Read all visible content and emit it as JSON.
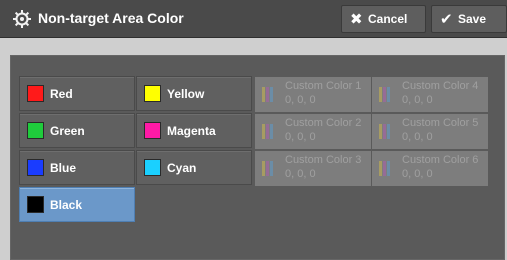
{
  "header": {
    "title": "Non-target Area Color",
    "cancel_label": "Cancel",
    "save_label": "Save"
  },
  "colors": [
    {
      "label": "Red",
      "color": "#ff1a1a"
    },
    {
      "label": "Yellow",
      "color": "#ffff00"
    },
    {
      "label": "Green",
      "color": "#1fcc3c"
    },
    {
      "label": "Magenta",
      "color": "#ff1aa6"
    },
    {
      "label": "Blue",
      "color": "#1a3cff"
    },
    {
      "label": "Cyan",
      "color": "#1ad0ff"
    },
    {
      "label": "Black",
      "color": "#000000",
      "selected": true
    }
  ],
  "custom_colors": [
    {
      "name": "Custom Color 1",
      "value": "0,  0,  0"
    },
    {
      "name": "Custom Color 4",
      "value": "0,  0,  0"
    },
    {
      "name": "Custom Color 2",
      "value": "0,  0,  0"
    },
    {
      "name": "Custom Color 5",
      "value": "0,  0,  0"
    },
    {
      "name": "Custom Color 3",
      "value": "0,  0,  0"
    },
    {
      "name": "Custom Color 6",
      "value": "0,  0,  0"
    }
  ],
  "custom_swatch_colors": [
    "#e6d36a",
    "#c77cc7",
    "#7ab8e6"
  ]
}
